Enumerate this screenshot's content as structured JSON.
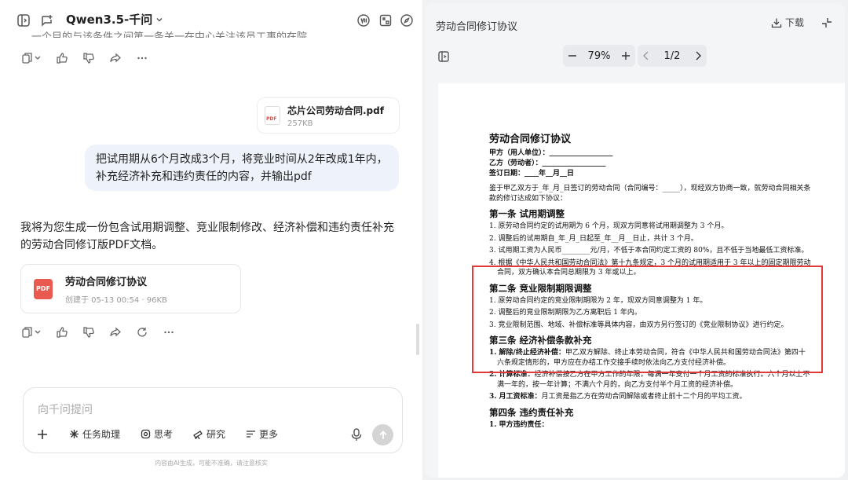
{
  "header": {
    "model_name": "Qwen3.5-千问",
    "truncated_text": "一个目的与该条件之间第一条关一在中心关注该员工事的在院中"
  },
  "upload": {
    "file_name": "芯片公司劳动合同.pdf",
    "file_size": "257KB",
    "file_type_label": "PDF"
  },
  "user_message": "把试用期从6个月改成3个月，将竞业时间从2年改成1年内，补充经济补充和违约责任的内容，并输出pdf",
  "assistant": {
    "reply": "我将为您生成一份包含试用期调整、竞业限制修改、经济补偿和违约责任补充的劳动合同修订版PDF文档。",
    "file": {
      "icon_label": "PDF",
      "name": "劳动合同修订协议",
      "meta": "创建于 05-13 00:54 · 96KB"
    }
  },
  "input": {
    "placeholder": "向千问提问",
    "tools": [
      "任务助理",
      "思考",
      "研究",
      "更多"
    ],
    "disclaimer": "内容由AI生成，可能不准确，请注意核实"
  },
  "viewer": {
    "title": "劳动合同修订协议",
    "download_label": "下载",
    "zoom": "79%",
    "page": "1/2",
    "colors": {
      "highlight_box": "#e23a3a"
    }
  },
  "doc": {
    "title": "劳动合同修订协议",
    "party_a": "甲方（用人单位）：__________________",
    "party_b": "乙方（劳动者）：__________________",
    "sign_date": "签订日期：____年__月__日",
    "intro": "鉴于甲乙双方于_年_月_日签订的劳动合同（合同编号：_____），现经双方协商一致，就劳动合同相关条款的修订达成如下协议：",
    "s1": {
      "title": "第一条 试用期调整",
      "items": [
        "1. 原劳动合同约定的试用期为 6 个月，现双方同意将试用期调整为 3 个月。",
        "2. 调整后的试用期自_年_月_日起至_年__月__日止，共计 3 个月。",
        "3. 试用期工资为人民币________元/月，不低于本合同约定工资的 80%，且不低于当地最低工资标准。",
        "4. 根据《中华人民共和国劳动合同法》第十九条规定，3 个月的试用期适用于 3 年以上的固定期限劳动合同，双方确认本合同总期限为 3 年或以上。"
      ]
    },
    "s2": {
      "title": "第二条 竞业限制期限调整",
      "items": [
        "1. 原劳动合同约定的竞业限制期限为 2 年，现双方同意调整为 1 年。",
        "2. 调整后的竞业限制期限为乙方离职后 1 年内。",
        "3. 竞业限制范围、地域、补偿标准等具体内容，由双方另行签订的《竞业限制协议》进行约定。"
      ]
    },
    "s3": {
      "title": "第三条 经济补偿条款补充",
      "items": [
        {
          "bold": "1. 解除/终止经济补偿：",
          "text": "甲乙双方解除、终止本劳动合同，符合《中华人民共和国劳动合同法》第四十六条规定情形的，甲方应在办结工作交接手续时依法向乙方支付经济补偿。"
        },
        {
          "bold": "2. 计算标准：",
          "text": "经济补偿按乙方在甲方工作的年限，每满一年支付一个月工资的标准执行。六个月以上不满一年的，按一年计算；不满六个月的，向乙方支付半个月工资的经济补偿。"
        },
        {
          "bold": "3. 月工资标准：",
          "text": "月工资是指乙方在劳动合同解除或者终止前十二个月的平均工资。"
        }
      ]
    },
    "s4": {
      "title": "第四条 违约责任补充",
      "item1": "1. 甲方违约责任："
    }
  }
}
